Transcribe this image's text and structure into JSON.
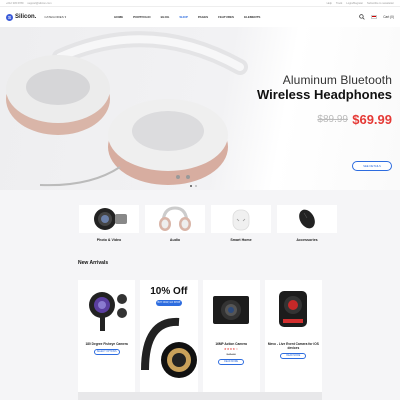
{
  "topbar": {
    "phone": "+012 345 6789",
    "email": "support@silicon.com",
    "links": [
      "Help",
      "Track",
      "Login/Register",
      "Subscribe to newsletter"
    ]
  },
  "header": {
    "logo_mark": "S",
    "logo_text": "Silicon.",
    "categories_label": "CATEGORIES ▾",
    "nav": [
      "HOME",
      "PORTFOLIO",
      "BLOG",
      "SHOP",
      "PAGES",
      "FEATURES",
      "ELEMENTS"
    ],
    "active_nav": "SHOP",
    "cart_label": "Cart (0)"
  },
  "hero": {
    "title_line1": "Aluminum Bluetooth",
    "title_line2": "Wireless Headphones",
    "old_price": "$89.99",
    "new_price": "$69.99",
    "button_label": "SEE DETAILS",
    "dots": 2,
    "active_dot": 0
  },
  "categories": [
    {
      "label": "Photo & Video",
      "icon": "camera-lens-icon"
    },
    {
      "label": "Audio",
      "icon": "headphones-icon"
    },
    {
      "label": "Smart Home",
      "icon": "smart-speaker-icon"
    },
    {
      "label": "Accessories",
      "icon": "mouse-icon"
    }
  ],
  "new_arrivals": {
    "title": "New Arrivals",
    "products": [
      {
        "name": "180 Degree Fisheye Camera",
        "old_price": "",
        "button": "SELECT OPTIONS",
        "stars": 0
      },
      {
        "promo": true,
        "title": "10% Off",
        "button": "BUY NOW, GO SHOP"
      },
      {
        "name": "16MP Action Camera",
        "stars": 4,
        "old_price": "$25.00",
        "button": "READ MORE"
      },
      {
        "name": "Mevo - Live Event Camera for iOS devices",
        "stars": 0,
        "old_price": "",
        "button": "READ MORE"
      }
    ]
  },
  "colors": {
    "accent": "#2d6cdf",
    "sale": "#e53935",
    "logo": "#3a5bd9"
  }
}
